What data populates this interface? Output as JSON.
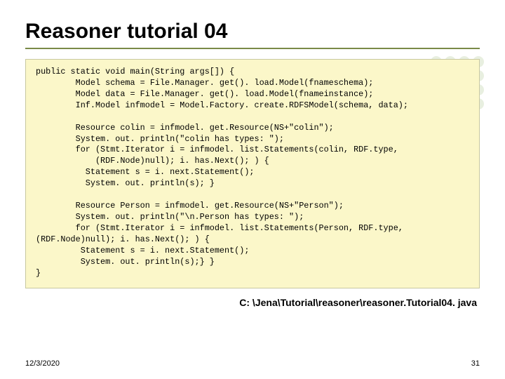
{
  "title": "Reasoner tutorial 04",
  "code_lines": [
    "public static void main(String args[]) {",
    "        Model schema = File.Manager. get(). load.Model(fnameschema);",
    "        Model data = File.Manager. get(). load.Model(fnameinstance);",
    "        Inf.Model infmodel = Model.Factory. create.RDFSModel(schema, data);",
    "",
    "        Resource colin = infmodel. get.Resource(NS+\"colin\");",
    "        System. out. println(\"colin has types: \");",
    "        for (Stmt.Iterator i = infmodel. list.Statements(colin, RDF.type,",
    "            (RDF.Node)null); i. has.Next(); ) {",
    "          Statement s = i. next.Statement();",
    "          System. out. println(s); }",
    "",
    "        Resource Person = infmodel. get.Resource(NS+\"Person\");",
    "        System. out. println(\"\\n.Person has types: \");",
    "        for (Stmt.Iterator i = infmodel. list.Statements(Person, RDF.type,",
    "(RDF.Node)null); i. has.Next(); ) {",
    "         Statement s = i. next.Statement();",
    "         System. out. println(s);} }",
    "}"
  ],
  "caption": "C: \\Jena\\Tutorial\\reasoner\\reasoner.Tutorial04. java",
  "footer": {
    "date": "12/3/2020",
    "page": "31"
  }
}
